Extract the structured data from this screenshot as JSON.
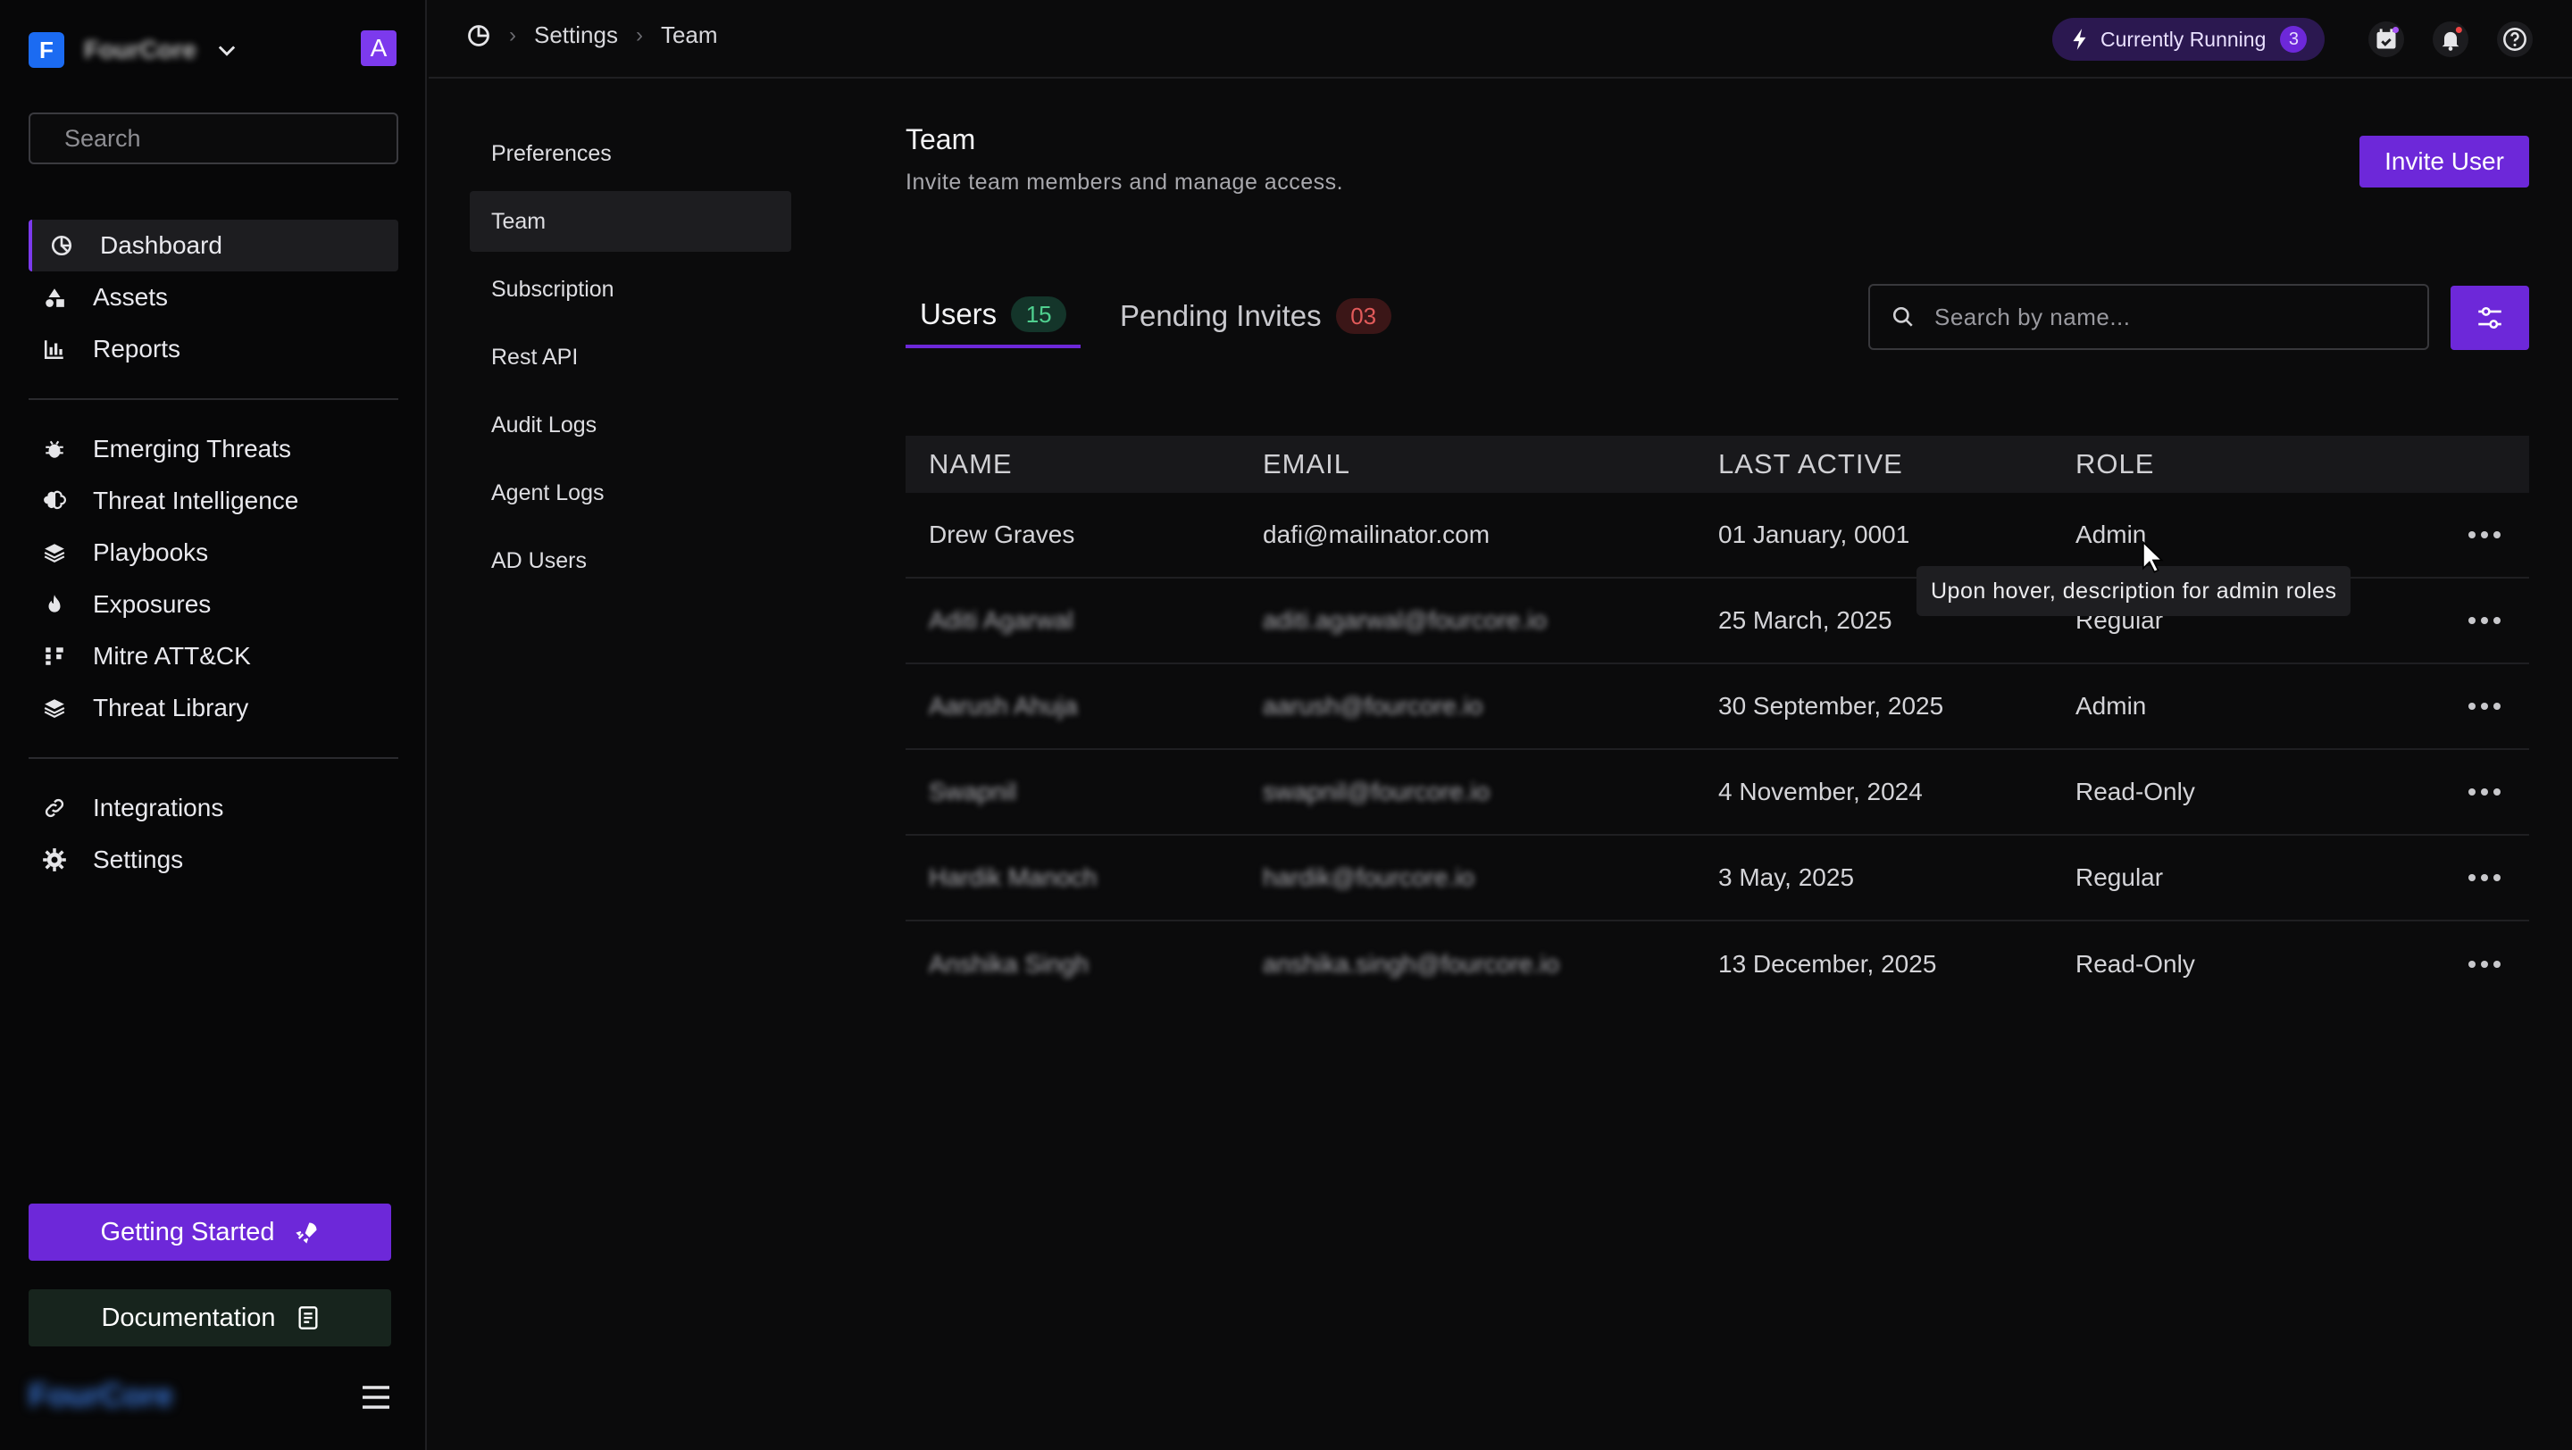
{
  "org": {
    "initial": "F",
    "name": "FourCore"
  },
  "user": {
    "initial": "A"
  },
  "sidebar": {
    "search_placeholder": "Search",
    "primary": [
      {
        "label": "Dashboard",
        "icon": "pie-chart-icon",
        "active": true
      },
      {
        "label": "Assets",
        "icon": "shapes-icon"
      },
      {
        "label": "Reports",
        "icon": "bar-chart-icon"
      }
    ],
    "threats": [
      {
        "label": "Emerging Threats",
        "icon": "bug-icon"
      },
      {
        "label": "Threat Intelligence",
        "icon": "brain-icon"
      },
      {
        "label": "Playbooks",
        "icon": "layers-icon"
      },
      {
        "label": "Exposures",
        "icon": "flame-icon"
      },
      {
        "label": "Mitre ATT&CK",
        "icon": "grid-icon"
      },
      {
        "label": "Threat Library",
        "icon": "stack-icon"
      }
    ],
    "other": [
      {
        "label": "Integrations",
        "icon": "link-icon"
      },
      {
        "label": "Settings",
        "icon": "gear-icon"
      }
    ],
    "getting_started": "Getting Started",
    "documentation": "Documentation",
    "footer_brand": "FourCore"
  },
  "topbar": {
    "breadcrumbs": [
      "Settings",
      "Team"
    ],
    "running_label": "Currently Running",
    "running_count": "3"
  },
  "settings_nav": [
    "Preferences",
    "Team",
    "Subscription",
    "Rest API",
    "Audit Logs",
    "Agent Logs",
    "AD Users"
  ],
  "main": {
    "title": "Team",
    "subtitle": "Invite team members and manage access.",
    "invite_label": "Invite User",
    "tabs": [
      {
        "label": "Users",
        "count": "15"
      },
      {
        "label": "Pending Invites",
        "count": "03"
      }
    ],
    "search_placeholder": "Search by name...",
    "columns": [
      "NAME",
      "EMAIL",
      "LAST ACTIVE",
      "ROLE"
    ],
    "rows": [
      {
        "name": "Drew Graves",
        "email": "dafi@mailinator.com",
        "last_active": "01 January, 0001",
        "role": "Admin"
      },
      {
        "name": "Aditi Agarwal",
        "email": "aditi.agarwal@fourcore.io",
        "last_active": "25 March, 2025",
        "role": "Regular"
      },
      {
        "name": "Aarush Ahuja",
        "email": "aarush@fourcore.io",
        "last_active": "30 September, 2025",
        "role": "Admin"
      },
      {
        "name": "Swapnil",
        "email": "swapnil@fourcore.io",
        "last_active": "4 November, 2024",
        "role": "Read-Only"
      },
      {
        "name": "Hardik Manoch",
        "email": "hardik@fourcore.io",
        "last_active": "3 May, 2025",
        "role": "Regular"
      },
      {
        "name": "Anshika Singh",
        "email": "anshika.singh@fourcore.io",
        "last_active": "13 December, 2025",
        "role": "Read-Only"
      }
    ],
    "tooltip": "Upon hover, description for admin roles"
  },
  "colors": {
    "accent": "#6d28d9",
    "background": "#0b0b0c",
    "green": "#4fd08f",
    "red": "#e25a5a"
  }
}
